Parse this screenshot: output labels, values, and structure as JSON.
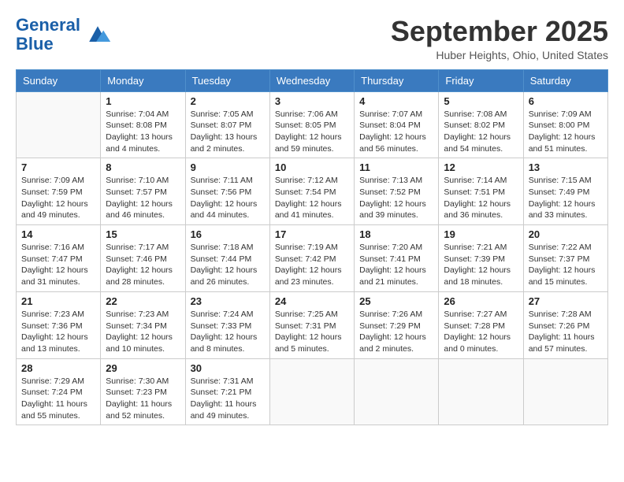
{
  "header": {
    "logo_line1": "General",
    "logo_line2": "Blue",
    "month_title": "September 2025",
    "location": "Huber Heights, Ohio, United States"
  },
  "days_of_week": [
    "Sunday",
    "Monday",
    "Tuesday",
    "Wednesday",
    "Thursday",
    "Friday",
    "Saturday"
  ],
  "weeks": [
    [
      {
        "day": "",
        "info": ""
      },
      {
        "day": "1",
        "info": "Sunrise: 7:04 AM\nSunset: 8:08 PM\nDaylight: 13 hours\nand 4 minutes."
      },
      {
        "day": "2",
        "info": "Sunrise: 7:05 AM\nSunset: 8:07 PM\nDaylight: 13 hours\nand 2 minutes."
      },
      {
        "day": "3",
        "info": "Sunrise: 7:06 AM\nSunset: 8:05 PM\nDaylight: 12 hours\nand 59 minutes."
      },
      {
        "day": "4",
        "info": "Sunrise: 7:07 AM\nSunset: 8:04 PM\nDaylight: 12 hours\nand 56 minutes."
      },
      {
        "day": "5",
        "info": "Sunrise: 7:08 AM\nSunset: 8:02 PM\nDaylight: 12 hours\nand 54 minutes."
      },
      {
        "day": "6",
        "info": "Sunrise: 7:09 AM\nSunset: 8:00 PM\nDaylight: 12 hours\nand 51 minutes."
      }
    ],
    [
      {
        "day": "7",
        "info": "Sunrise: 7:09 AM\nSunset: 7:59 PM\nDaylight: 12 hours\nand 49 minutes."
      },
      {
        "day": "8",
        "info": "Sunrise: 7:10 AM\nSunset: 7:57 PM\nDaylight: 12 hours\nand 46 minutes."
      },
      {
        "day": "9",
        "info": "Sunrise: 7:11 AM\nSunset: 7:56 PM\nDaylight: 12 hours\nand 44 minutes."
      },
      {
        "day": "10",
        "info": "Sunrise: 7:12 AM\nSunset: 7:54 PM\nDaylight: 12 hours\nand 41 minutes."
      },
      {
        "day": "11",
        "info": "Sunrise: 7:13 AM\nSunset: 7:52 PM\nDaylight: 12 hours\nand 39 minutes."
      },
      {
        "day": "12",
        "info": "Sunrise: 7:14 AM\nSunset: 7:51 PM\nDaylight: 12 hours\nand 36 minutes."
      },
      {
        "day": "13",
        "info": "Sunrise: 7:15 AM\nSunset: 7:49 PM\nDaylight: 12 hours\nand 33 minutes."
      }
    ],
    [
      {
        "day": "14",
        "info": "Sunrise: 7:16 AM\nSunset: 7:47 PM\nDaylight: 12 hours\nand 31 minutes."
      },
      {
        "day": "15",
        "info": "Sunrise: 7:17 AM\nSunset: 7:46 PM\nDaylight: 12 hours\nand 28 minutes."
      },
      {
        "day": "16",
        "info": "Sunrise: 7:18 AM\nSunset: 7:44 PM\nDaylight: 12 hours\nand 26 minutes."
      },
      {
        "day": "17",
        "info": "Sunrise: 7:19 AM\nSunset: 7:42 PM\nDaylight: 12 hours\nand 23 minutes."
      },
      {
        "day": "18",
        "info": "Sunrise: 7:20 AM\nSunset: 7:41 PM\nDaylight: 12 hours\nand 21 minutes."
      },
      {
        "day": "19",
        "info": "Sunrise: 7:21 AM\nSunset: 7:39 PM\nDaylight: 12 hours\nand 18 minutes."
      },
      {
        "day": "20",
        "info": "Sunrise: 7:22 AM\nSunset: 7:37 PM\nDaylight: 12 hours\nand 15 minutes."
      }
    ],
    [
      {
        "day": "21",
        "info": "Sunrise: 7:23 AM\nSunset: 7:36 PM\nDaylight: 12 hours\nand 13 minutes."
      },
      {
        "day": "22",
        "info": "Sunrise: 7:23 AM\nSunset: 7:34 PM\nDaylight: 12 hours\nand 10 minutes."
      },
      {
        "day": "23",
        "info": "Sunrise: 7:24 AM\nSunset: 7:33 PM\nDaylight: 12 hours\nand 8 minutes."
      },
      {
        "day": "24",
        "info": "Sunrise: 7:25 AM\nSunset: 7:31 PM\nDaylight: 12 hours\nand 5 minutes."
      },
      {
        "day": "25",
        "info": "Sunrise: 7:26 AM\nSunset: 7:29 PM\nDaylight: 12 hours\nand 2 minutes."
      },
      {
        "day": "26",
        "info": "Sunrise: 7:27 AM\nSunset: 7:28 PM\nDaylight: 12 hours\nand 0 minutes."
      },
      {
        "day": "27",
        "info": "Sunrise: 7:28 AM\nSunset: 7:26 PM\nDaylight: 11 hours\nand 57 minutes."
      }
    ],
    [
      {
        "day": "28",
        "info": "Sunrise: 7:29 AM\nSunset: 7:24 PM\nDaylight: 11 hours\nand 55 minutes."
      },
      {
        "day": "29",
        "info": "Sunrise: 7:30 AM\nSunset: 7:23 PM\nDaylight: 11 hours\nand 52 minutes."
      },
      {
        "day": "30",
        "info": "Sunrise: 7:31 AM\nSunset: 7:21 PM\nDaylight: 11 hours\nand 49 minutes."
      },
      {
        "day": "",
        "info": ""
      },
      {
        "day": "",
        "info": ""
      },
      {
        "day": "",
        "info": ""
      },
      {
        "day": "",
        "info": ""
      }
    ]
  ]
}
